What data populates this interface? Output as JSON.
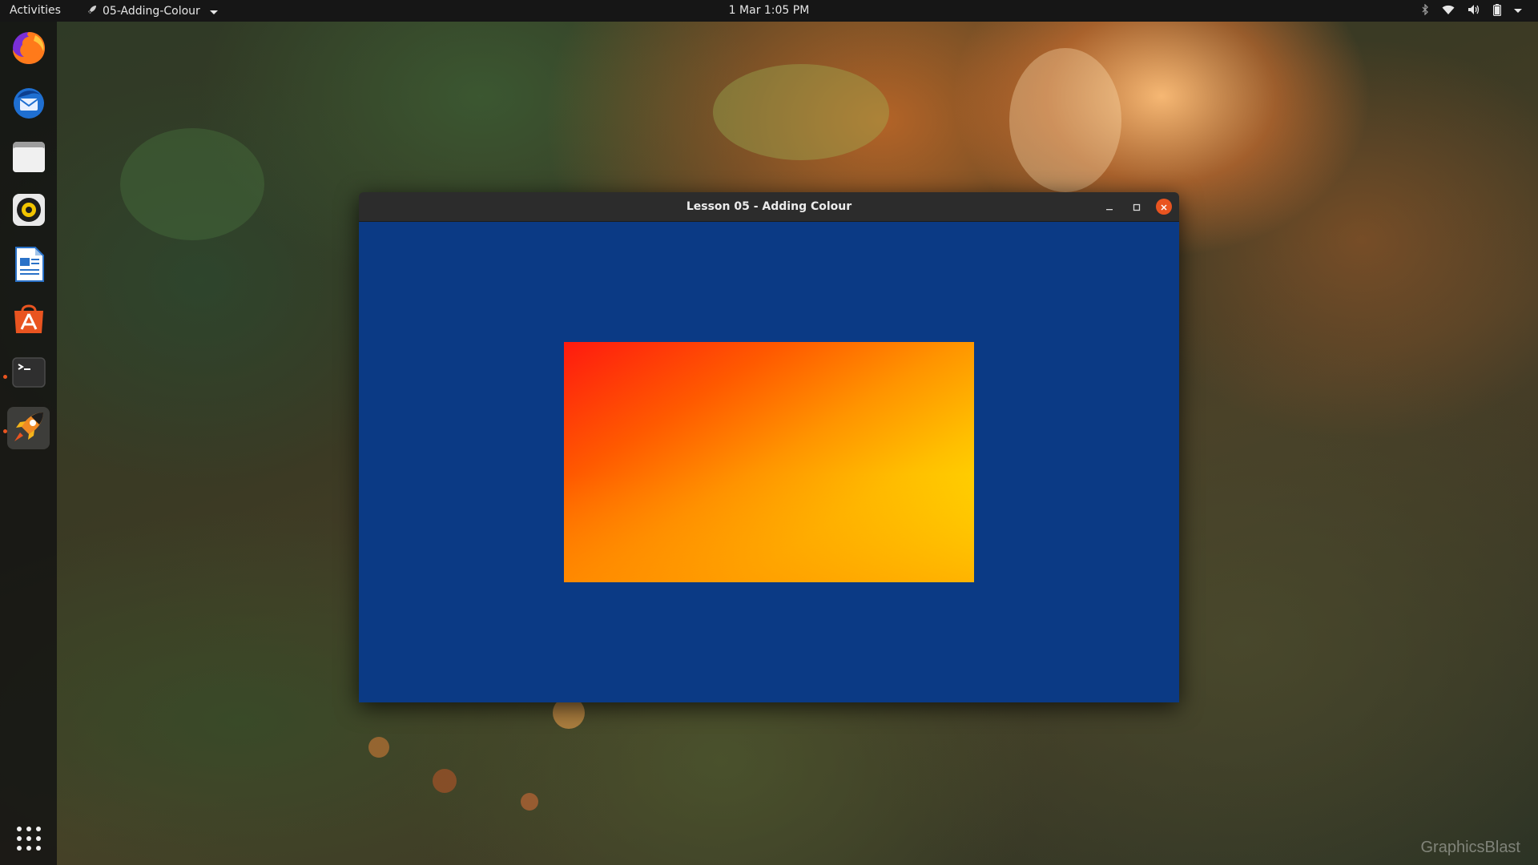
{
  "topbar": {
    "activities": "Activities",
    "app_name": "05-Adding-Colour",
    "app_icon": "rocket-icon",
    "clock": "1 Mar  1:05 PM",
    "tray_icons": [
      "bluetooth-icon",
      "wifi-icon",
      "volume-icon",
      "battery-icon",
      "system-menu-arrow-icon"
    ]
  },
  "dock": {
    "items": [
      {
        "name": "Firefox",
        "icon": "firefox-icon"
      },
      {
        "name": "Thunderbird",
        "icon": "thunderbird-icon"
      },
      {
        "name": "Files",
        "icon": "files-icon"
      },
      {
        "name": "Rhythmbox",
        "icon": "rhythmbox-icon"
      },
      {
        "name": "LibreOffice Writer",
        "icon": "writer-icon"
      },
      {
        "name": "Ubuntu Software",
        "icon": "software-icon"
      },
      {
        "name": "Terminal",
        "icon": "terminal-icon"
      },
      {
        "name": "05-Adding-Colour",
        "icon": "rocket-icon"
      }
    ],
    "show_apps_icon": "apps-grid-icon"
  },
  "window": {
    "title": "Lesson 05 - Adding Colour",
    "clear_color": "#0b3a85",
    "quad_gradient": [
      "#ff1a0f",
      "#ff9400",
      "#fff000"
    ]
  },
  "colors": {
    "accent": "#e95420",
    "topbar": "#161616",
    "dock": "#121212"
  },
  "watermark": "GraphicsBlast"
}
